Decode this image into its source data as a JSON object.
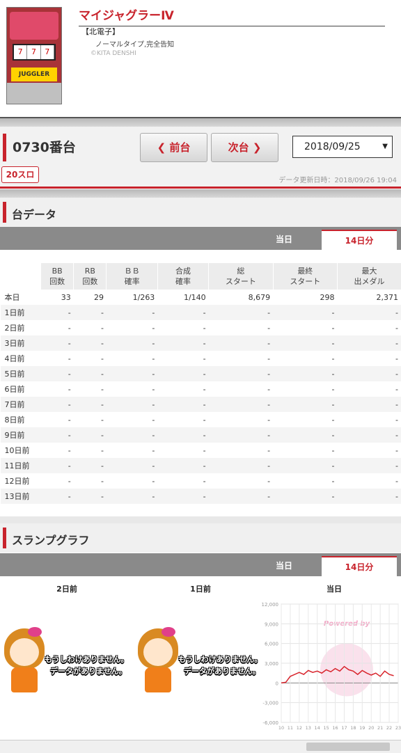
{
  "machine": {
    "title": "マイジャグラーⅣ",
    "maker": "【北電子】",
    "spec": "ノーマルタイプ,完全告知",
    "copyright": "©KITA DENSHI",
    "image_logo": "JUGGLER"
  },
  "unit": {
    "number": "0730番台",
    "prev_label": "前台",
    "next_label": "次台",
    "date": "2018/09/25",
    "tag": "20スロ",
    "updated": "データ更新日時：2018/09/26 19:04"
  },
  "data_section": {
    "title": "台データ",
    "tabs": [
      "当日",
      "14日分"
    ],
    "active_tab": "14日分",
    "columns": [
      "",
      "BB\n回数",
      "RB\n回数",
      "ＢＢ\n確率",
      "合成\n確率",
      "総\nスタート",
      "最終\nスタート",
      "最大\n出メダル"
    ],
    "rows": [
      [
        "本日",
        "33",
        "29",
        "1/263",
        "1/140",
        "8,679",
        "298",
        "2,371"
      ],
      [
        "1日前",
        "-",
        "-",
        "-",
        "-",
        "-",
        "-",
        "-"
      ],
      [
        "2日前",
        "-",
        "-",
        "-",
        "-",
        "-",
        "-",
        "-"
      ],
      [
        "3日前",
        "-",
        "-",
        "-",
        "-",
        "-",
        "-",
        "-"
      ],
      [
        "4日前",
        "-",
        "-",
        "-",
        "-",
        "-",
        "-",
        "-"
      ],
      [
        "5日前",
        "-",
        "-",
        "-",
        "-",
        "-",
        "-",
        "-"
      ],
      [
        "6日前",
        "-",
        "-",
        "-",
        "-",
        "-",
        "-",
        "-"
      ],
      [
        "7日前",
        "-",
        "-",
        "-",
        "-",
        "-",
        "-",
        "-"
      ],
      [
        "8日前",
        "-",
        "-",
        "-",
        "-",
        "-",
        "-",
        "-"
      ],
      [
        "9日前",
        "-",
        "-",
        "-",
        "-",
        "-",
        "-",
        "-"
      ],
      [
        "10日前",
        "-",
        "-",
        "-",
        "-",
        "-",
        "-",
        "-"
      ],
      [
        "11日前",
        "-",
        "-",
        "-",
        "-",
        "-",
        "-",
        "-"
      ],
      [
        "12日前",
        "-",
        "-",
        "-",
        "-",
        "-",
        "-",
        "-"
      ],
      [
        "13日前",
        "-",
        "-",
        "-",
        "-",
        "-",
        "-",
        "-"
      ]
    ]
  },
  "graph_section": {
    "title": "スランプグラフ",
    "tabs": [
      "当日",
      "14日分"
    ],
    "active_tab": "14日分",
    "col_titles": [
      "2日前",
      "1日前",
      "当日"
    ],
    "nodata_line1": "もうしわけありません。",
    "nodata_line2": "データがありません。",
    "watermark": "Powered by"
  },
  "chart_data": {
    "type": "line",
    "title": "",
    "xlabel": "",
    "ylabel": "",
    "x": [
      10,
      11,
      12,
      13,
      14,
      15,
      16,
      17,
      18,
      19,
      20,
      21,
      22,
      23
    ],
    "x_ticks": [
      "10",
      "11",
      "12",
      "13",
      "14",
      "15",
      "16",
      "17",
      "18",
      "19",
      "20",
      "21",
      "22",
      "23"
    ],
    "y_ticks": [
      "12,000",
      "9,000",
      "6,000",
      "3,000",
      "0",
      "-3,000",
      "-6,000"
    ],
    "ylim": [
      -6000,
      12000
    ],
    "series": [
      {
        "color": "#d8242c",
        "points": [
          [
            10,
            0
          ],
          [
            10.5,
            100
          ],
          [
            11,
            1000
          ],
          [
            11.5,
            1300
          ],
          [
            12,
            1600
          ],
          [
            12.5,
            1300
          ],
          [
            13,
            1900
          ],
          [
            13.5,
            1600
          ],
          [
            14,
            1800
          ],
          [
            14.5,
            1500
          ],
          [
            15,
            2000
          ],
          [
            15.5,
            1700
          ],
          [
            16,
            2200
          ],
          [
            16.5,
            1800
          ],
          [
            17,
            2500
          ],
          [
            17.5,
            2000
          ],
          [
            18,
            1800
          ],
          [
            18.5,
            1300
          ],
          [
            19,
            1900
          ],
          [
            19.5,
            1500
          ],
          [
            20,
            1200
          ],
          [
            20.5,
            1500
          ],
          [
            21,
            1000
          ],
          [
            21.5,
            1800
          ],
          [
            22,
            1300
          ],
          [
            22.5,
            1100
          ]
        ]
      }
    ],
    "grid": true,
    "legend": "none"
  }
}
